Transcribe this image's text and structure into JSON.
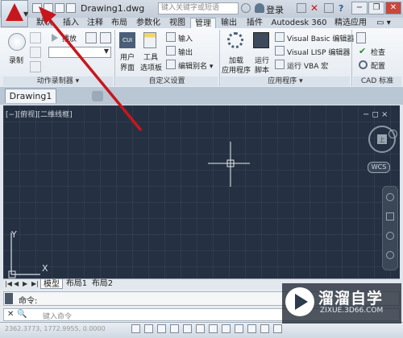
{
  "title": {
    "file": "Drawing1.dwg",
    "search_placeholder": "键入关键字或短语",
    "signin": "登录",
    "help": "?"
  },
  "tabs": [
    "默认",
    "插入",
    "注释",
    "布局",
    "参数化",
    "视图",
    "管理",
    "输出",
    "插件",
    "Autodesk 360",
    "精选应用"
  ],
  "active_tab": "管理",
  "ribbon": {
    "action_recorder": {
      "record": "录制",
      "play": "播放",
      "label": "动作录制器"
    },
    "customize": {
      "user_interface": [
        "用户",
        "界面"
      ],
      "tool_palette": [
        "工具",
        "选项板"
      ],
      "import": "输入",
      "export": "输出",
      "edit_alias": "编辑别名",
      "label": "自定义设置"
    },
    "applications": {
      "load_app": [
        "加载",
        "应用程序"
      ],
      "run_script": [
        "运行",
        "脚本"
      ],
      "vba_editor": "Visual Basic 编辑器",
      "lisp_editor": "Visual LISP 编辑器",
      "run_vba": "运行 VBA 宏",
      "label": "应用程序"
    },
    "cad_standards": {
      "check": "检查",
      "configure": "配置",
      "label": "CAD 标准"
    }
  },
  "file_tab": "Drawing1",
  "viewport": {
    "label": "[−][俯视][二维线框]",
    "controls": "−  ◻  ×",
    "wcs": "WCS",
    "y_axis": "Y",
    "x_axis": "X"
  },
  "layout_tabs": [
    "模型",
    "布局1",
    "布局2"
  ],
  "command": {
    "history": "命令:",
    "prompt": "键入命令"
  },
  "status": {
    "coords": "2362.3773, 1772.9955, 0.0000"
  },
  "watermark": {
    "name": "溜溜自学",
    "url": "ZIXUE.3D66.COM"
  },
  "colors": {
    "canvas": "#253142",
    "arrow": "#c8161d",
    "accent": "#c8161d"
  }
}
